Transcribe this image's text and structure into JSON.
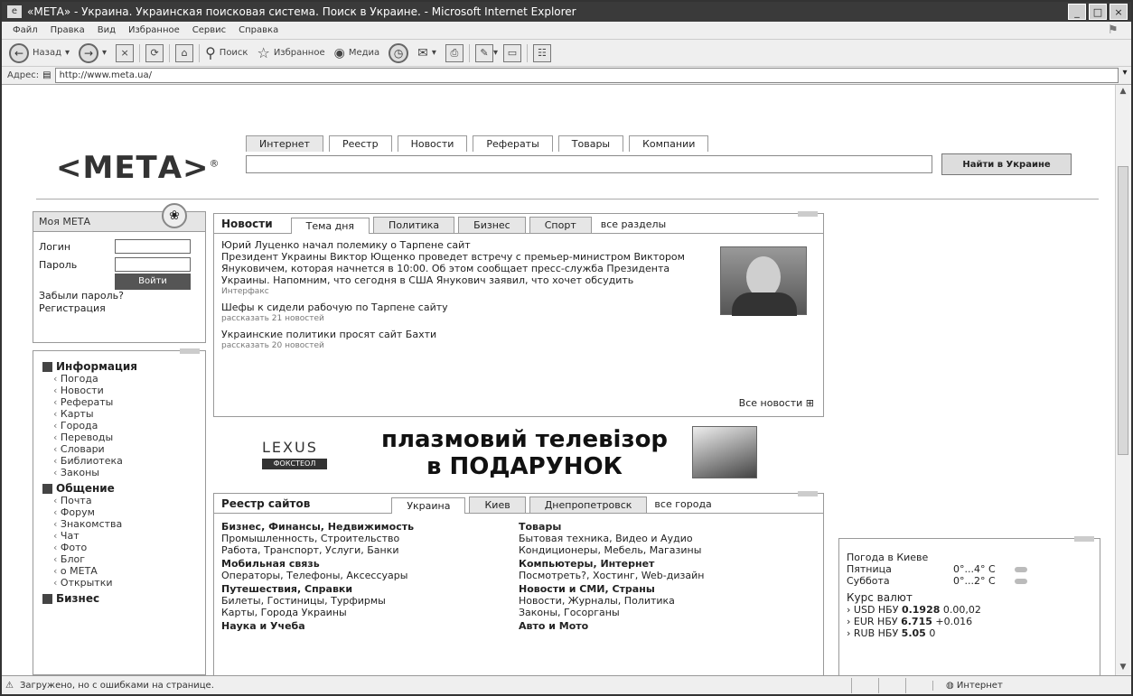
{
  "window": {
    "title": "«МЕТА» - Украина. Украинская поисковая система. Поиск в Украине. - Microsoft Internet Explorer",
    "buttons": [
      "_",
      "□",
      "×"
    ]
  },
  "menu": [
    "Файл",
    "Правка",
    "Вид",
    "Избранное",
    "Сервис",
    "Справка"
  ],
  "toolbar": {
    "back": "Назад",
    "search": "Поиск",
    "favorites": "Избранное",
    "media": "Медиа"
  },
  "address": {
    "label": "Адрес:",
    "value": "http://www.meta.ua/"
  },
  "status": {
    "text": "Загружено, но с ошибками на странице.",
    "zone": "Интернет"
  },
  "page": {
    "logo": "<МЕТА>",
    "logo_mark": "®",
    "search_tabs": [
      "Интернет",
      "Реестр",
      "Новости",
      "Рефераты",
      "Товары",
      "Компании"
    ],
    "search_button": "Найти в Украине",
    "mymeta": {
      "title": "Моя МЕТА",
      "login_label": "Логин",
      "password_label": "Пароль",
      "login_button": "Войти",
      "forgot": "Забыли пароль?",
      "register": "Регистрация"
    },
    "nav": {
      "info_title": "Информация",
      "info_items": [
        "Погода",
        "Новости",
        "Рефераты",
        "Карты",
        "Города",
        "Переводы",
        "Словари",
        "Библиотека",
        "Законы"
      ],
      "comm_title": "Общение",
      "comm_items": [
        "Почта",
        "Форум",
        "Знакомства",
        "Чат",
        "Фото",
        "Блог",
        "о МЕТА",
        "Открытки"
      ],
      "biz_title": "Бизнес"
    },
    "news": {
      "label": "Новости",
      "tabs": [
        "Тема дня",
        "Политика",
        "Бизнес",
        "Спорт"
      ],
      "all": "все разделы",
      "headline": "Юрий Луценко начал полемику о Тарпене сайт",
      "body": "Президент Украины Виктор Ющенко проведет встречу с премьер-министром Виктором Януковичем, которая начнется в 10:00. Об этом сообщает пресс-служба Президента Украины. Напомним, что сегодня в США Янукович заявил, что хочет обсудить",
      "source": "Интерфакс",
      "items": [
        {
          "text": "Шефы к сидели рабочую по Тарпене сайту",
          "meta": "рассказать 21 новостей"
        },
        {
          "text": "Украинские политики просят сайт Бахти",
          "meta": "рассказать 20 новостей"
        }
      ],
      "all_news": "Все новости"
    },
    "banner": {
      "brand": "LEXUS",
      "brand_sub": "ФОКСТЕОЛ",
      "line1": "плазмовий телевізор",
      "line2": "в ПОДАРУНОК"
    },
    "registry": {
      "label": "Реестр сайтов",
      "tabs": [
        "Украина",
        "Киев",
        "Днепропетровск"
      ],
      "all": "все города",
      "col1": [
        {
          "cat": "Бизнес, Финансы, Недвижимость",
          "sub": "Промышленность, Строительство"
        },
        {
          "cat": "",
          "sub": "Работа, Транспорт, Услуги, Банки"
        },
        {
          "cat": "Мобильная связь",
          "sub": "Операторы, Телефоны, Аксессуары"
        },
        {
          "cat": "Путешествия, Справки",
          "sub": "Билеты, Гостиницы, Турфирмы"
        },
        {
          "cat": "",
          "sub": "Карты, Города Украины"
        },
        {
          "cat": "Наука и Учеба",
          "sub": ""
        }
      ],
      "col2": [
        {
          "cat": "Товары",
          "sub": "Бытовая техника, Видео и Аудио"
        },
        {
          "cat": "",
          "sub": "Кондиционеры, Мебель, Магазины"
        },
        {
          "cat": "Компьютеры, Интернет",
          "sub": "Посмотреть?, Хостинг, Web-дизайн"
        },
        {
          "cat": "Новости и СМИ, Страны",
          "sub": "Новости, Журналы, Политика"
        },
        {
          "cat": "",
          "sub": "Законы, Госорганы"
        },
        {
          "cat": "Авто и Мото",
          "sub": ""
        }
      ]
    },
    "weather": {
      "title": "Погода в Киеве",
      "rows": [
        {
          "day": "Пятница",
          "temp": "0°...4° С"
        },
        {
          "day": "Суббота",
          "temp": "0°...2° С"
        }
      ],
      "rates_title": "Курс валют",
      "rates": [
        {
          "label": "USD НБУ",
          "value": "0.1928",
          "delta": "0.00,02"
        },
        {
          "label": "EUR НБУ",
          "value": "6.715",
          "delta": "+0.016"
        },
        {
          "label": "RUB НБУ",
          "value": "5.05",
          "delta": "0"
        }
      ]
    }
  }
}
